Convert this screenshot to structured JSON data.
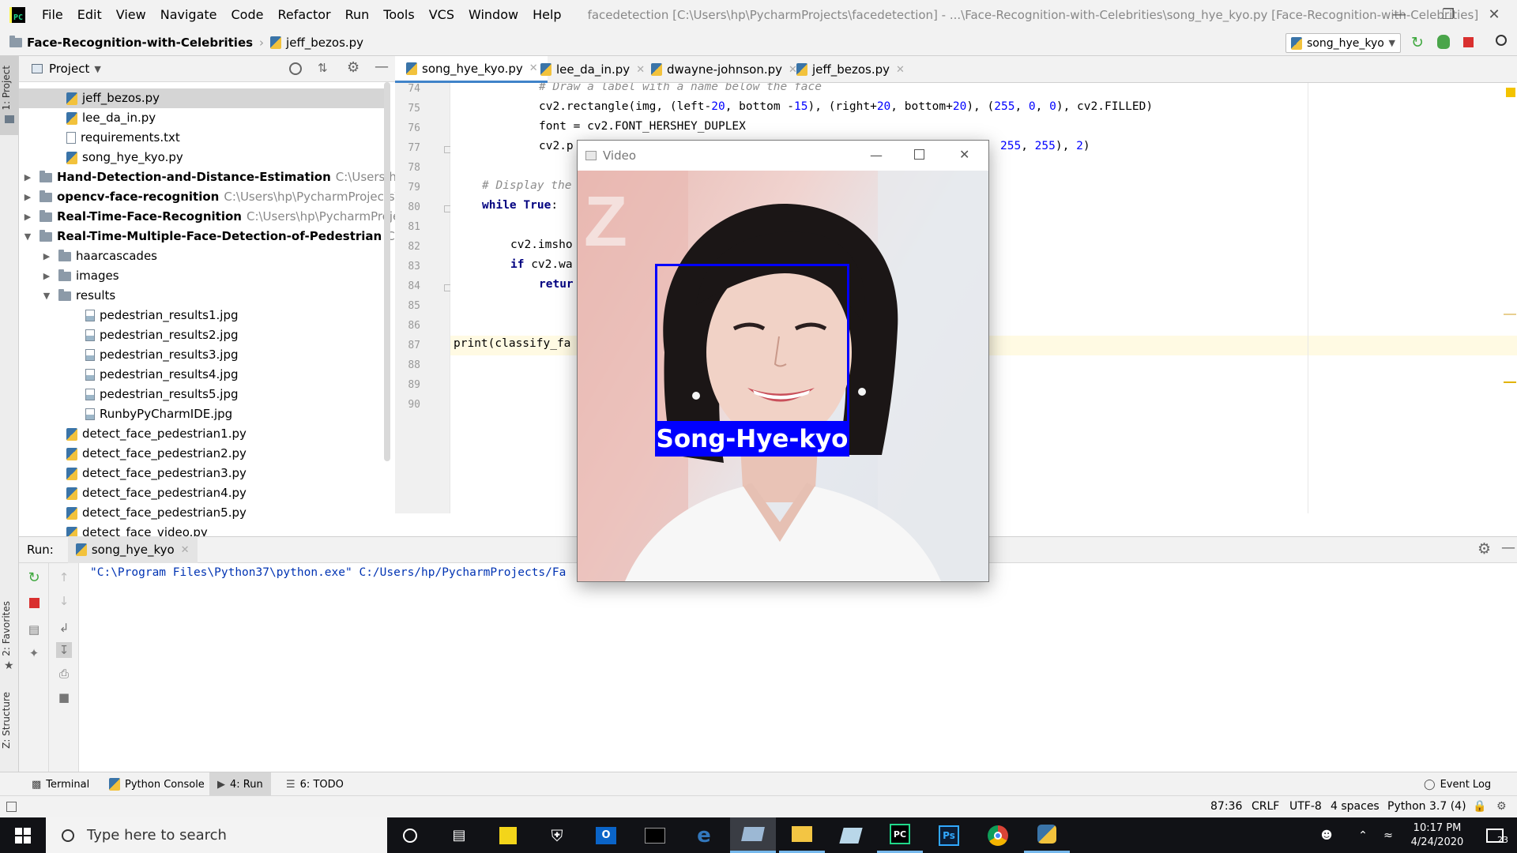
{
  "window": {
    "title": "facedetection [C:\\Users\\hp\\PycharmProjects\\facedetection] - ...\\Face-Recognition-with-Celebrities\\song_hye_kyo.py [Face-Recognition-with-Celebrities]"
  },
  "menu": [
    "File",
    "Edit",
    "View",
    "Navigate",
    "Code",
    "Refactor",
    "Run",
    "Tools",
    "VCS",
    "Window",
    "Help"
  ],
  "breadcrumb": {
    "project": "Face-Recognition-with-Celebrities",
    "file": "jeff_bezos.py"
  },
  "run_config": "song_hye_kyo",
  "side_tabs": {
    "project": "1: Project",
    "favorites": "2: Favorites",
    "structure": "Z: Structure"
  },
  "project_panel": {
    "title": "Project",
    "rows": [
      {
        "name": "jeff_bezos.py",
        "type": "py"
      },
      {
        "name": "lee_da_in.py",
        "type": "py"
      },
      {
        "name": "requirements.txt",
        "type": "txt"
      },
      {
        "name": "song_hye_kyo.py",
        "type": "py"
      },
      {
        "name": "Hand-Detection-and-Distance-Estimation",
        "path": "C:\\Users\\hp\\Pychar",
        "type": "folder"
      },
      {
        "name": "opencv-face-recognition",
        "path": "C:\\Users\\hp\\PycharmProjects\\opencv",
        "type": "folder"
      },
      {
        "name": "Real-Time-Face-Recognition",
        "path": "C:\\Users\\hp\\PycharmProjects\\Rea",
        "type": "folder"
      },
      {
        "name": "Real-Time-Multiple-Face-Detection-of-Pedestrian",
        "path": "C:\\Users\\h",
        "type": "folder"
      },
      {
        "name": "haarcascades",
        "type": "folder"
      },
      {
        "name": "images",
        "type": "folder"
      },
      {
        "name": "results",
        "type": "folder"
      },
      {
        "name": "pedestrian_results1.jpg",
        "type": "img"
      },
      {
        "name": "pedestrian_results2.jpg",
        "type": "img"
      },
      {
        "name": "pedestrian_results3.jpg",
        "type": "img"
      },
      {
        "name": "pedestrian_results4.jpg",
        "type": "img"
      },
      {
        "name": "pedestrian_results5.jpg",
        "type": "img"
      },
      {
        "name": "RunbyPyCharmIDE.jpg",
        "type": "img"
      },
      {
        "name": "detect_face_pedestrian1.py",
        "type": "py"
      },
      {
        "name": "detect_face_pedestrian2.py",
        "type": "py"
      },
      {
        "name": "detect_face_pedestrian3.py",
        "type": "py"
      },
      {
        "name": "detect_face_pedestrian4.py",
        "type": "py"
      },
      {
        "name": "detect_face_pedestrian5.py",
        "type": "py"
      },
      {
        "name": "detect_face_video.py",
        "type": "py"
      }
    ]
  },
  "editor_tabs": [
    "song_hye_kyo.py",
    "lee_da_in.py",
    "dwayne-johnson.py",
    "jeff_bezos.py"
  ],
  "editor": {
    "line_numbers": [
      "74",
      "75",
      "76",
      "77",
      "78",
      "79",
      "80",
      "81",
      "82",
      "83",
      "84",
      "85",
      "86",
      "87",
      "88",
      "89",
      "90"
    ],
    "lines": {
      "l74": "# Draw a label with a name below the face",
      "l75a": "cv2.rectangle(img, (left-",
      "l75n1": "20",
      "l75b": ", bottom -",
      "l75n2": "15",
      "l75c": "), (right+",
      "l75n3": "20",
      "l75d": ", bottom+",
      "l75n4": "20",
      "l75e": "), (",
      "l75n5": "255",
      "l75f": ", ",
      "l75n6": "0",
      "l75g": ", ",
      "l75n7": "0",
      "l75h": "), cv2.FILLED)",
      "l76": "font = cv2.FONT_HERSHEY_DUPLEX",
      "l77a": "cv2.p",
      "l77n1": "255",
      "l77b": ", ",
      "l77n2": "255",
      "l77c": "), ",
      "l77n3": "2",
      "l77d": ")",
      "l79": "# Display the",
      "l80kw1": "while",
      "l80kw2": "True",
      "l80b": ":",
      "l82": "cv2.imsho",
      "l83kw": "if",
      "l83b": " cv2.wa",
      "l84kw": "retur",
      "l87": "print(classify_fa"
    }
  },
  "run_panel": {
    "label": "Run:",
    "tab": "song_hye_kyo",
    "console": "\"C:\\Program Files\\Python37\\python.exe\" C:/Users/hp/PycharmProjects/Fa"
  },
  "tool_tabs": [
    "Terminal",
    "Python Console",
    "4: Run",
    "6: TODO"
  ],
  "event_log": "Event Log",
  "status": {
    "position": "87:36",
    "line_sep": "CRLF",
    "encoding": "UTF-8",
    "indent": "4 spaces",
    "interpreter": "Python 3.7 (4)"
  },
  "video_window": {
    "title": "Video",
    "label": "Song-Hye-kyo",
    "box_color": "#0000ff"
  },
  "taskbar": {
    "search_placeholder": "Type here to search",
    "time": "10:17 PM",
    "date": "4/24/2020",
    "notifications": "23",
    "apps": [
      "cortana-icon",
      "task-view-icon",
      "sticky-notes-icon",
      "security-icon",
      "outlook-icon",
      "terminal-icon",
      "edge-icon",
      "window-icon",
      "file-explorer-icon",
      "paper-icon",
      "pycharm-icon",
      "photoshop-icon",
      "chrome-icon",
      "python-icon"
    ]
  }
}
